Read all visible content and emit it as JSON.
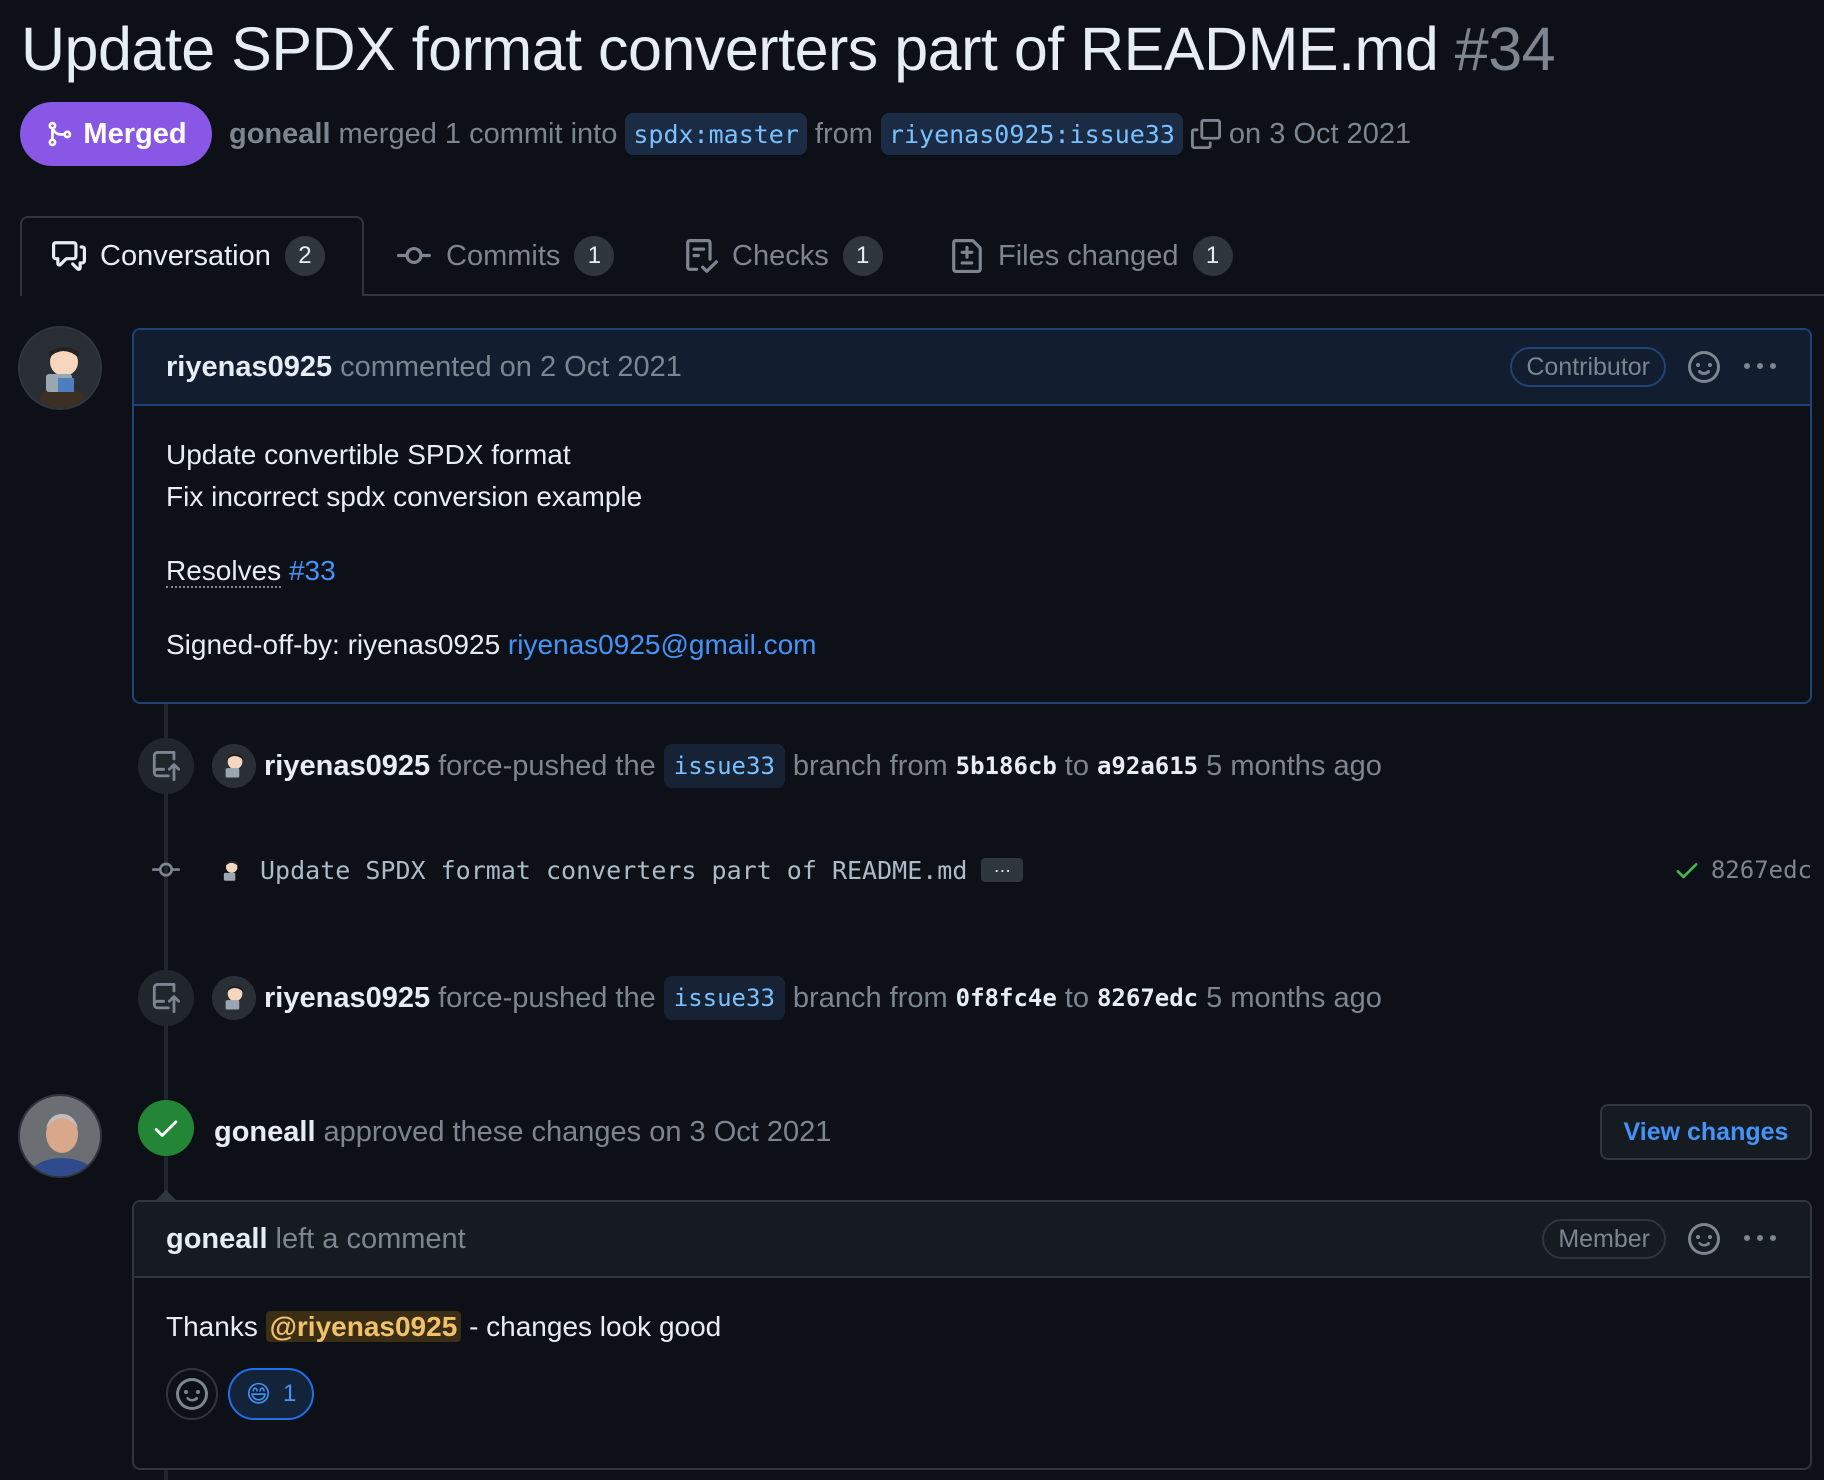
{
  "pr": {
    "title": "Update SPDX format converters part of README.md",
    "number": "#34",
    "status": "Merged",
    "merger": "goneall",
    "merge_text": "merged 1 commit into",
    "base_branch": "spdx:master",
    "from_text": "from",
    "head_branch": "riyenas0925:issue33",
    "merge_date": "on 3 Oct 2021"
  },
  "tabs": [
    {
      "label": "Conversation",
      "count": "2"
    },
    {
      "label": "Commits",
      "count": "1"
    },
    {
      "label": "Checks",
      "count": "1"
    },
    {
      "label": "Files changed",
      "count": "1"
    }
  ],
  "first_comment": {
    "author": "riyenas0925",
    "meta": "commented on 2 Oct 2021",
    "role": "Contributor",
    "line1": "Update convertible SPDX format",
    "line2": "Fix incorrect spdx conversion example",
    "resolves_label": "Resolves",
    "resolves_link": "#33",
    "signed_label": "Signed-off-by: riyenas0925",
    "signed_email": "riyenas0925@gmail.com"
  },
  "events": [
    {
      "author": "riyenas0925",
      "action": "force-pushed the",
      "branch": "issue33",
      "from_text": "branch from",
      "from_sha": "5b186cb",
      "to_text": "to",
      "to_sha": "a92a615",
      "time": "5 months ago"
    },
    {
      "author": "riyenas0925",
      "action": "force-pushed the",
      "branch": "issue33",
      "from_text": "branch from",
      "from_sha": "0f8fc4e",
      "to_text": "to",
      "to_sha": "8267edc",
      "time": "5 months ago"
    }
  ],
  "commit": {
    "message": "Update SPDX format converters part of README.md",
    "ellipsis": "…",
    "sha": "8267edc"
  },
  "review": {
    "author": "goneall",
    "text": "approved these changes on 3 Oct 2021",
    "view_button": "View changes"
  },
  "review_comment": {
    "author": "goneall",
    "meta": "left a comment",
    "role": "Member",
    "thanks": "Thanks",
    "mention": "@riyenas0925",
    "rest": "- changes look good",
    "reaction_emoji": "😄",
    "reaction_count": "1"
  },
  "colors": {
    "background": "#0d1117",
    "merged": "#8957e5",
    "link": "#4493f8",
    "approve": "#238636"
  }
}
